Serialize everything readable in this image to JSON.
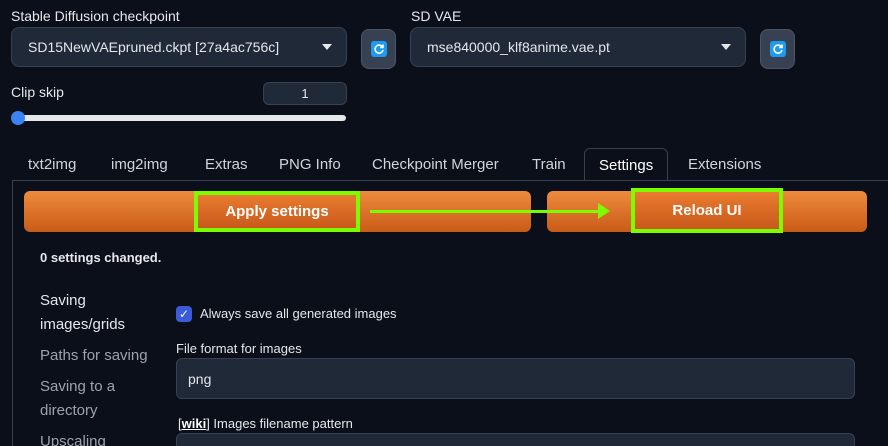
{
  "checkpoint": {
    "label": "Stable Diffusion checkpoint",
    "value": "SD15NewVAEpruned.ckpt [27a4ac756c]"
  },
  "vae": {
    "label": "SD VAE",
    "value": "mse840000_klf8anime.vae.pt"
  },
  "clip_skip": {
    "label": "Clip skip",
    "value": "1",
    "slider_fraction": 0.0
  },
  "tabs": [
    {
      "label": "txt2img"
    },
    {
      "label": "img2img"
    },
    {
      "label": "Extras"
    },
    {
      "label": "PNG Info"
    },
    {
      "label": "Checkpoint Merger"
    },
    {
      "label": "Train"
    },
    {
      "label": "Settings"
    },
    {
      "label": "Extensions"
    }
  ],
  "active_tab": "Settings",
  "actions": {
    "apply": "Apply settings",
    "reload": "Reload UI"
  },
  "status": "0 settings changed.",
  "sidebar": {
    "items": [
      {
        "label": "Saving images/grids"
      },
      {
        "label": "Paths for saving"
      },
      {
        "label": "Saving to a directory"
      },
      {
        "label": "Upscaling"
      }
    ]
  },
  "settings": {
    "always_save_label": "Always save all generated images",
    "always_save_checked": true,
    "file_format_label": "File format for images",
    "file_format_value": "png",
    "filename_pattern_prefix": "[",
    "filename_pattern_wiki": "wiki",
    "filename_pattern_suffix": "] Images filename pattern"
  },
  "colors": {
    "accent_orange": "#d8691f",
    "highlight_green": "#7cfc00",
    "checkbox_blue": "#3b5bdb",
    "slider_blue": "#3b82f6"
  }
}
